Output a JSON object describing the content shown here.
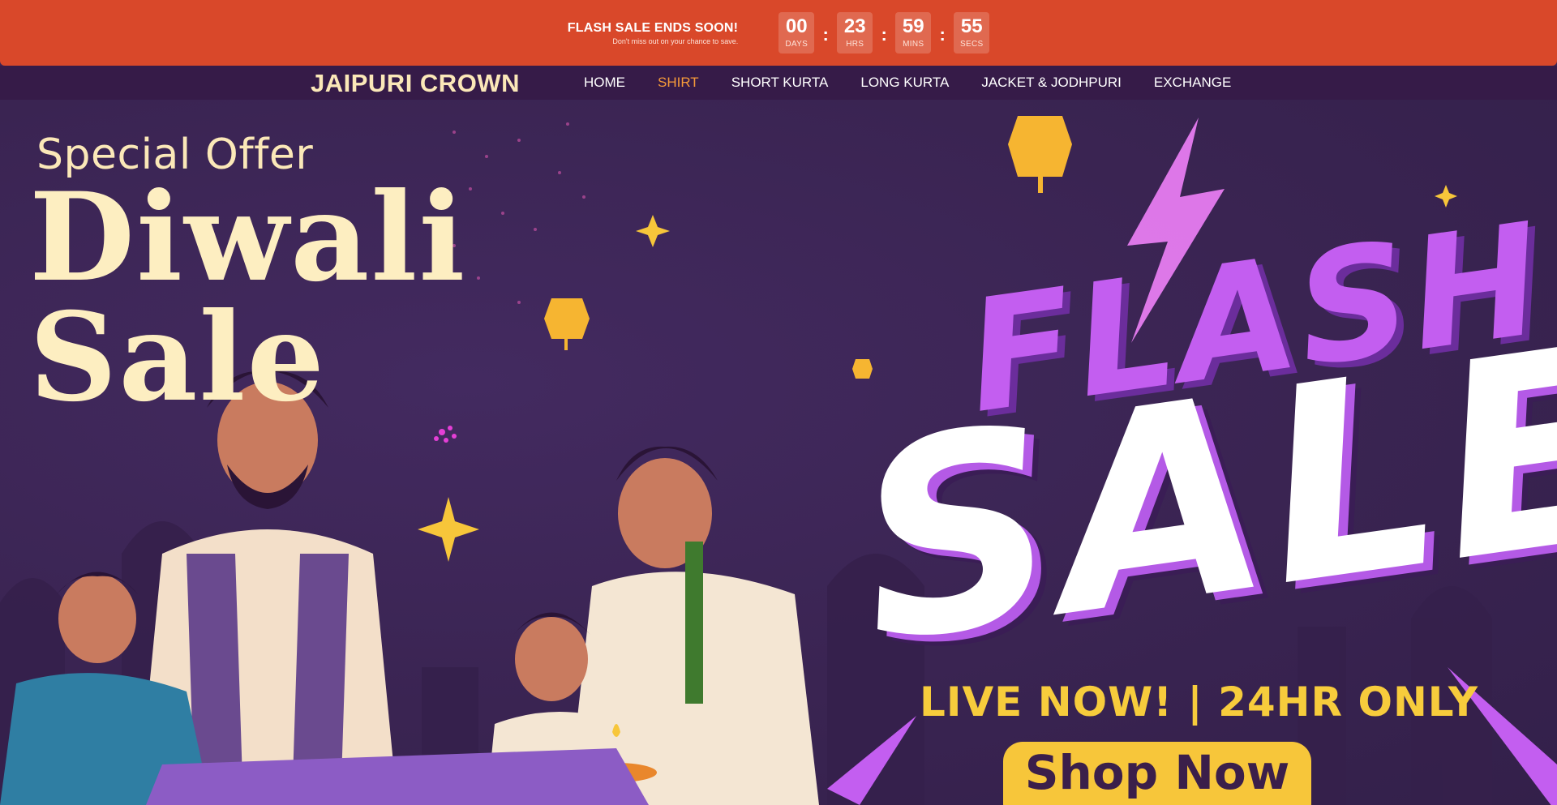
{
  "announcement": {
    "title": "FLASH SALE ENDS SOON!",
    "subtitle": "Don't miss out on your chance to save.",
    "countdown": [
      {
        "value": "00",
        "label": "DAYS"
      },
      {
        "value": "23",
        "label": "HRS"
      },
      {
        "value": "59",
        "label": "MINS"
      },
      {
        "value": "55",
        "label": "SECS"
      }
    ],
    "separator": ":"
  },
  "header": {
    "logo": "JAIPURI CROWN",
    "menu": [
      {
        "label": "HOME",
        "active": false
      },
      {
        "label": "SHIRT",
        "active": true
      },
      {
        "label": "SHORT KURTA",
        "active": false
      },
      {
        "label": "LONG KURTA",
        "active": false
      },
      {
        "label": "JACKET & JODHPURI",
        "active": false
      },
      {
        "label": "EXCHANGE",
        "active": false
      }
    ]
  },
  "hero": {
    "special_offer": "Special Offer",
    "headline_line1": "Diwali",
    "headline_line2": "Sale",
    "flash_text": "FLASH",
    "sale_text": "SALE",
    "tagline": "LIVE NOW! | 24HR ONLY",
    "cta_label": "Shop Now"
  },
  "colors": {
    "announcement_bg": "#d9482a",
    "nav_bg": "#361b48",
    "hero_bg": "#3b2553",
    "logo": "#fbe8b8",
    "active_link": "#f59a3a",
    "accent_yellow": "#f7c63a",
    "accent_purple": "#c35ef0"
  }
}
